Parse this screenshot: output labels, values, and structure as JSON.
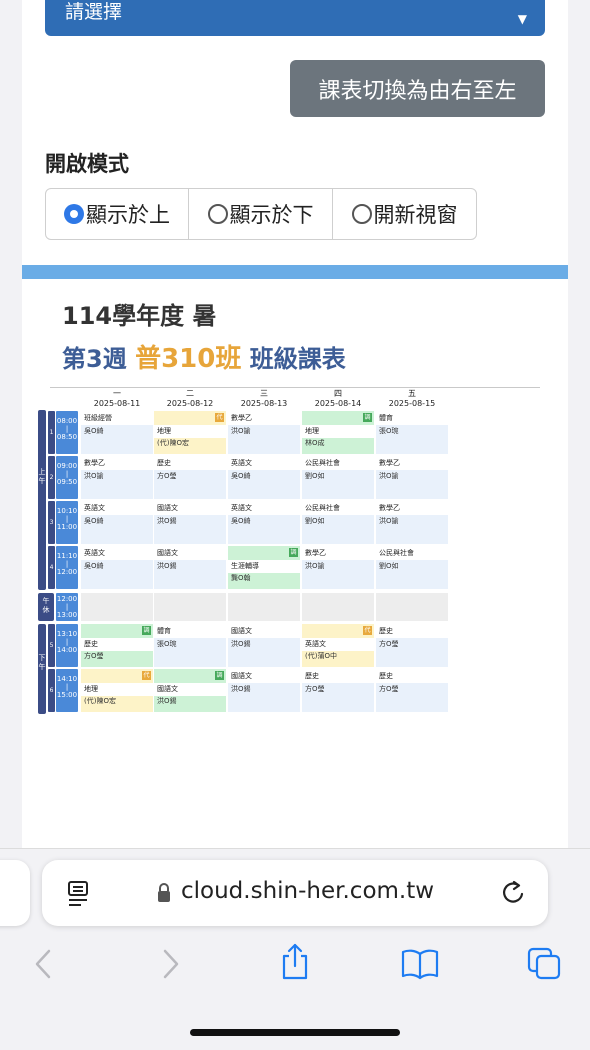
{
  "top": {
    "select_text": "請選擇",
    "switch_button": "課表切換為由右至左",
    "mode_label": "開啟模式",
    "modes": [
      "顯示於上",
      "顯示於下",
      "開新視窗"
    ]
  },
  "timetable": {
    "title_line1": "114學年度 暑",
    "week": "第3週",
    "class_name": "普310班",
    "table_label": "班級課表",
    "days": [
      {
        "name": "一",
        "date": "2025-08-11"
      },
      {
        "name": "二",
        "date": "2025-08-12"
      },
      {
        "name": "三",
        "date": "2025-08-13"
      },
      {
        "name": "四",
        "date": "2025-08-14"
      },
      {
        "name": "五",
        "date": "2025-08-15"
      }
    ],
    "am_label": [
      "上",
      "午"
    ],
    "pm_label": [
      "下",
      "午"
    ],
    "lunch_label": [
      "午",
      "休"
    ],
    "periods": [
      {
        "num": "1",
        "start": "08:00",
        "sep": "|",
        "end": "08:50"
      },
      {
        "num": "2",
        "start": "09:00",
        "sep": "|",
        "end": "09:50"
      },
      {
        "num": "3",
        "start": "10:10",
        "sep": "|",
        "end": "11:00"
      },
      {
        "num": "4",
        "start": "11:10",
        "sep": "|",
        "end": "12:00"
      },
      {
        "num": "",
        "start": "12:00",
        "sep": "|",
        "end": "13:00"
      },
      {
        "num": "5",
        "start": "13:10",
        "sep": "|",
        "end": "14:00"
      },
      {
        "num": "6",
        "start": "14:10",
        "sep": "|",
        "end": "15:00"
      }
    ],
    "rows": [
      [
        {
          "subject": "班級經營",
          "teacher": "吳O綺",
          "style": "plain",
          "badge": ""
        },
        {
          "subject": "地理",
          "teacher": "(代)陳O宏",
          "style": "yellow",
          "badge": "代"
        },
        {
          "subject": "數學乙",
          "teacher": "洪O諭",
          "style": "plain",
          "badge": ""
        },
        {
          "subject": "地理",
          "teacher": "林O成",
          "style": "green",
          "badge": "調"
        },
        {
          "subject": "體育",
          "teacher": "張O琬",
          "style": "plain",
          "badge": ""
        }
      ],
      [
        {
          "subject": "數學乙",
          "teacher": "洪O諭",
          "style": "plain",
          "badge": ""
        },
        {
          "subject": "歷史",
          "teacher": "方O瑩",
          "style": "plain",
          "badge": ""
        },
        {
          "subject": "英語文",
          "teacher": "吳O綺",
          "style": "plain",
          "badge": ""
        },
        {
          "subject": "公民與社會",
          "teacher": "劉O如",
          "style": "plain",
          "badge": ""
        },
        {
          "subject": "數學乙",
          "teacher": "洪O諭",
          "style": "plain",
          "badge": ""
        }
      ],
      [
        {
          "subject": "英語文",
          "teacher": "吳O綺",
          "style": "plain",
          "badge": ""
        },
        {
          "subject": "國語文",
          "teacher": "洪O錫",
          "style": "plain",
          "badge": ""
        },
        {
          "subject": "英語文",
          "teacher": "吳O綺",
          "style": "plain",
          "badge": ""
        },
        {
          "subject": "公民與社會",
          "teacher": "劉O如",
          "style": "plain",
          "badge": ""
        },
        {
          "subject": "數學乙",
          "teacher": "洪O諭",
          "style": "plain",
          "badge": ""
        }
      ],
      [
        {
          "subject": "英語文",
          "teacher": "吳O綺",
          "style": "plain",
          "badge": ""
        },
        {
          "subject": "國語文",
          "teacher": "洪O錫",
          "style": "plain",
          "badge": ""
        },
        {
          "subject": "生涯輔導",
          "teacher": "龔O翰",
          "style": "green",
          "badge": "調"
        },
        {
          "subject": "數學乙",
          "teacher": "洪O諭",
          "style": "plain",
          "badge": ""
        },
        {
          "subject": "公民與社會",
          "teacher": "劉O如",
          "style": "plain",
          "badge": ""
        }
      ],
      "lunch",
      [
        {
          "subject": "歷史",
          "teacher": "方O瑩",
          "style": "green",
          "badge": "調"
        },
        {
          "subject": "體育",
          "teacher": "張O琬",
          "style": "plain",
          "badge": ""
        },
        {
          "subject": "國語文",
          "teacher": "洪O錫",
          "style": "plain",
          "badge": ""
        },
        {
          "subject": "英語文",
          "teacher": "(代)蒲O中",
          "style": "yellow",
          "badge": "代"
        },
        {
          "subject": "歷史",
          "teacher": "方O瑩",
          "style": "plain",
          "badge": ""
        }
      ],
      [
        {
          "subject": "地理",
          "teacher": "(代)陳O宏",
          "style": "yellow",
          "badge": "代"
        },
        {
          "subject": "國語文",
          "teacher": "洪O錫",
          "style": "green",
          "badge": "調"
        },
        {
          "subject": "國語文",
          "teacher": "洪O錫",
          "style": "plain",
          "badge": ""
        },
        {
          "subject": "歷史",
          "teacher": "方O瑩",
          "style": "plain",
          "badge": ""
        },
        {
          "subject": "歷史",
          "teacher": "方O瑩",
          "style": "plain",
          "badge": ""
        }
      ]
    ]
  },
  "browser": {
    "url": "cloud.shin-her.com.tw",
    "reader_icon": "reader-icon",
    "lock_icon": "lock-icon",
    "reload_icon": "reload-icon",
    "back_icon": "back-icon",
    "forward_icon": "forward-icon",
    "share_icon": "share-icon",
    "bookmarks_icon": "bookmarks-icon",
    "tabs_icon": "tabs-icon"
  },
  "colors": {
    "primary": "#2f6db5",
    "accent_orange": "#e7a53a",
    "title_blue": "#3d5d96",
    "ios_blue": "#1e7cf2"
  }
}
